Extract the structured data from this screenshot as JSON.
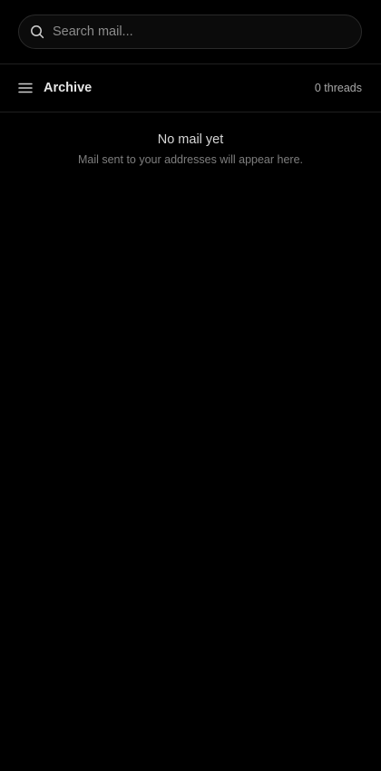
{
  "search": {
    "placeholder": "Search mail...",
    "value": "",
    "icon": "search-icon"
  },
  "header": {
    "menu_icon": "hamburger-menu-icon",
    "folder": "Archive",
    "thread_count": "0 threads"
  },
  "empty_state": {
    "title": "No mail yet",
    "subtitle": "Mail sent to your addresses will appear here."
  },
  "colors": {
    "background": "#000000",
    "text_primary": "#e6e6e6",
    "text_muted": "#7e7e7e",
    "border": "#2a2a2a"
  }
}
